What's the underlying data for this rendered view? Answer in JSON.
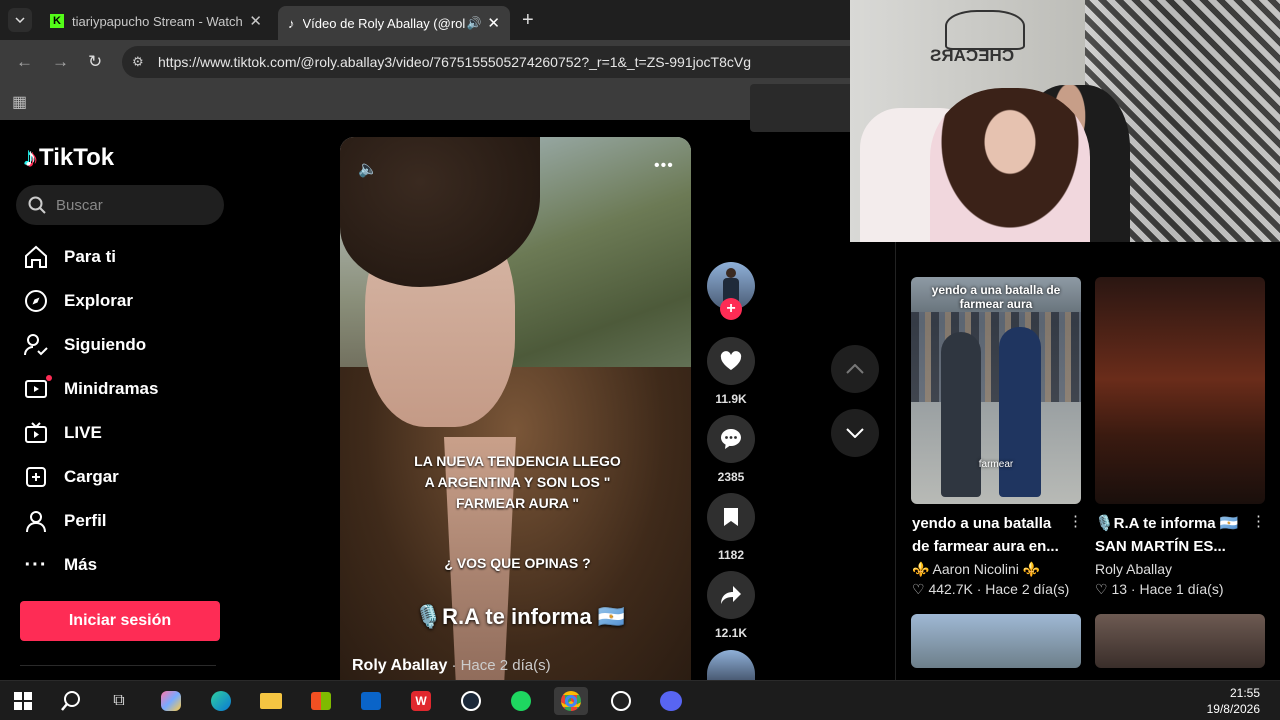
{
  "browser": {
    "tabs": [
      {
        "title": "tiariypapucho Stream - Watch L",
        "icon": "kick-icon",
        "close": "✕"
      },
      {
        "title": "Vídeo de Roly Aballay (@rol",
        "icon": "tiktok-icon",
        "close": "✕"
      }
    ],
    "new_tab": "+",
    "url": "https://www.tiktok.com/@roly.aballay3/video/7675155505274260752?_r=1&_t=ZS-991jocT8cVg"
  },
  "tiktok": {
    "logo_text": "TikTok",
    "search_placeholder": "Buscar",
    "nav": [
      {
        "label": "Para ti",
        "icon": "home-icon"
      },
      {
        "label": "Explorar",
        "icon": "compass-icon"
      },
      {
        "label": "Siguiendo",
        "icon": "following-icon"
      },
      {
        "label": "Minidramas",
        "icon": "film-icon"
      },
      {
        "label": "LIVE",
        "icon": "live-tv-icon"
      },
      {
        "label": "Cargar",
        "icon": "upload-icon"
      },
      {
        "label": "Perfil",
        "icon": "profile-icon"
      },
      {
        "label": "Más",
        "icon": "more-icon"
      }
    ],
    "login_label": "Iniciar sesión"
  },
  "video": {
    "caption_main": "LA NUEVA TENDENCIA LLEGO A ARGENTINA Y SON LOS \" FARMEAR AURA \"",
    "caption_question": "¿ VOS QUE OPINAS ?",
    "brand_text": "🎙️R.A te informa 🇦🇷",
    "author": "Roly Aballay",
    "time_ago": "· Hace 2 día(s)",
    "actions": {
      "likes": "11.9K",
      "comments": "2385",
      "saves": "1182",
      "shares": "12.1K"
    }
  },
  "related": [
    {
      "thumb_caption": "yendo a una batalla de farmear aura",
      "thumb_tag": "farmear",
      "title": "yendo a una batalla de farmear aura en...",
      "author": "⚜️ Aaron Nicolini ⚜️",
      "likes": "♡ 442.7K",
      "ago": "· Hace 2 día(s)"
    },
    {
      "title": "🎙️R.A te informa 🇦🇷 SAN MARTÍN ES...",
      "author": "Roly Aballay",
      "likes": "♡ 13",
      "ago": "· Hace 1 día(s)"
    }
  ],
  "webcam": {
    "logo_text": "CHECARS"
  },
  "taskbar": {
    "time": "21:55",
    "date": "19/8/2026",
    "apps": [
      "windows-icon",
      "search-icon",
      "task-view-icon",
      "copilot-icon",
      "edge-icon",
      "file-explorer-icon",
      "store-icon",
      "outlook-icon",
      "wps-icon",
      "steam-icon",
      "spotify-icon",
      "chrome-icon",
      "obs-icon",
      "discord-icon"
    ]
  },
  "colors": {
    "accent": "#fe2c55",
    "background": "#000000"
  }
}
